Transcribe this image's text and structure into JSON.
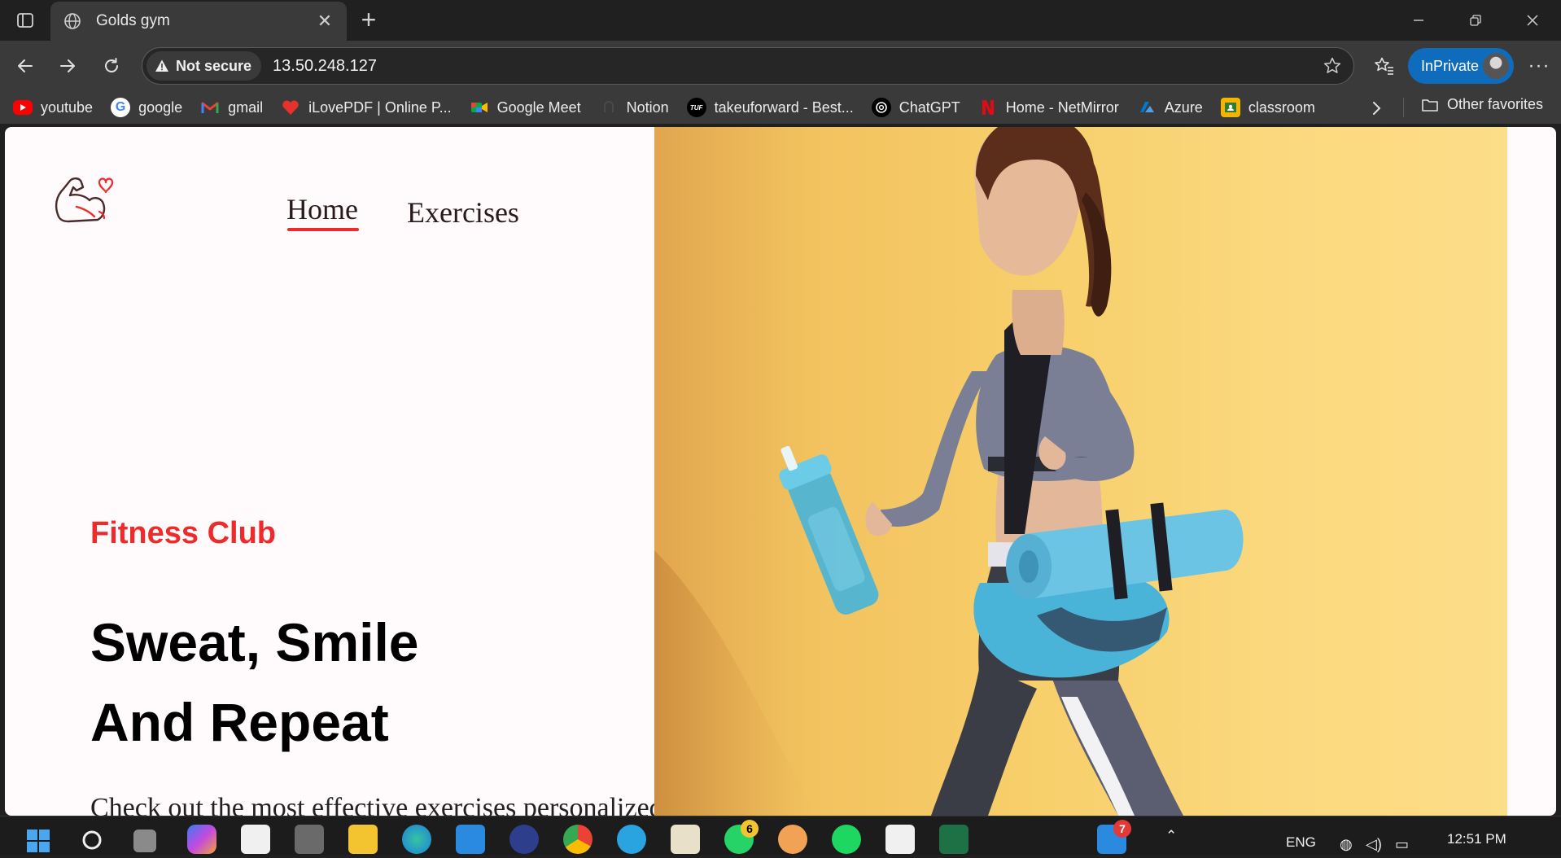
{
  "browser": {
    "tab_title": "Golds gym",
    "security_label": "Not secure",
    "url": "13.50.248.127",
    "inprivate_label": "InPrivate"
  },
  "bookmarks": [
    {
      "label": "youtube",
      "icon": "youtube-icon",
      "color": "#ff0000"
    },
    {
      "label": "google",
      "icon": "google-icon",
      "color": "#ffffff"
    },
    {
      "label": "gmail",
      "icon": "gmail-icon",
      "color": "#ea4335"
    },
    {
      "label": "iLovePDF | Online P...",
      "icon": "ilovepdf-icon",
      "color": "#e5322d"
    },
    {
      "label": "Google Meet",
      "icon": "google-meet-icon",
      "color": "#00897b"
    },
    {
      "label": "Notion",
      "icon": "notion-icon",
      "color": "#3a3a3a"
    },
    {
      "label": "takeuforward - Best...",
      "icon": "takeuforward-icon",
      "color": "#000000"
    },
    {
      "label": "ChatGPT",
      "icon": "chatgpt-icon",
      "color": "#000000"
    },
    {
      "label": "Home - NetMirror",
      "icon": "netmirror-icon",
      "color": "#e50914"
    },
    {
      "label": "Azure",
      "icon": "azure-icon",
      "color": "#0078d4"
    },
    {
      "label": "classroom",
      "icon": "classroom-icon",
      "color": "#f4b400"
    }
  ],
  "other_favorites": "Other favorites",
  "page": {
    "nav": {
      "home": "Home",
      "exercises": "Exercises"
    },
    "hero": {
      "eyebrow": "Fitness Club",
      "title_line1": "Sweat, Smile",
      "title_line2": "And Repeat",
      "description": "Check out the most effective exercises personalized to you"
    },
    "accent_color": "#ee2a2a"
  },
  "taskbar": {
    "whatsapp_badge": "6",
    "app_badge": "7",
    "language": "ENG",
    "time": "12:51 PM"
  }
}
